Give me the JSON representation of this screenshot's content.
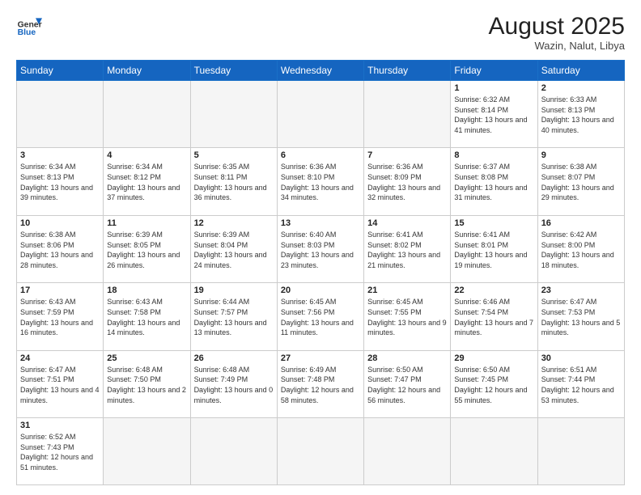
{
  "header": {
    "logo_general": "General",
    "logo_blue": "Blue",
    "month_year": "August 2025",
    "location": "Wazin, Nalut, Libya"
  },
  "weekdays": [
    "Sunday",
    "Monday",
    "Tuesday",
    "Wednesday",
    "Thursday",
    "Friday",
    "Saturday"
  ],
  "weeks": [
    [
      {
        "day": "",
        "info": ""
      },
      {
        "day": "",
        "info": ""
      },
      {
        "day": "",
        "info": ""
      },
      {
        "day": "",
        "info": ""
      },
      {
        "day": "",
        "info": ""
      },
      {
        "day": "1",
        "info": "Sunrise: 6:32 AM\nSunset: 8:14 PM\nDaylight: 13 hours and 41 minutes."
      },
      {
        "day": "2",
        "info": "Sunrise: 6:33 AM\nSunset: 8:13 PM\nDaylight: 13 hours and 40 minutes."
      }
    ],
    [
      {
        "day": "3",
        "info": "Sunrise: 6:34 AM\nSunset: 8:13 PM\nDaylight: 13 hours and 39 minutes."
      },
      {
        "day": "4",
        "info": "Sunrise: 6:34 AM\nSunset: 8:12 PM\nDaylight: 13 hours and 37 minutes."
      },
      {
        "day": "5",
        "info": "Sunrise: 6:35 AM\nSunset: 8:11 PM\nDaylight: 13 hours and 36 minutes."
      },
      {
        "day": "6",
        "info": "Sunrise: 6:36 AM\nSunset: 8:10 PM\nDaylight: 13 hours and 34 minutes."
      },
      {
        "day": "7",
        "info": "Sunrise: 6:36 AM\nSunset: 8:09 PM\nDaylight: 13 hours and 32 minutes."
      },
      {
        "day": "8",
        "info": "Sunrise: 6:37 AM\nSunset: 8:08 PM\nDaylight: 13 hours and 31 minutes."
      },
      {
        "day": "9",
        "info": "Sunrise: 6:38 AM\nSunset: 8:07 PM\nDaylight: 13 hours and 29 minutes."
      }
    ],
    [
      {
        "day": "10",
        "info": "Sunrise: 6:38 AM\nSunset: 8:06 PM\nDaylight: 13 hours and 28 minutes."
      },
      {
        "day": "11",
        "info": "Sunrise: 6:39 AM\nSunset: 8:05 PM\nDaylight: 13 hours and 26 minutes."
      },
      {
        "day": "12",
        "info": "Sunrise: 6:39 AM\nSunset: 8:04 PM\nDaylight: 13 hours and 24 minutes."
      },
      {
        "day": "13",
        "info": "Sunrise: 6:40 AM\nSunset: 8:03 PM\nDaylight: 13 hours and 23 minutes."
      },
      {
        "day": "14",
        "info": "Sunrise: 6:41 AM\nSunset: 8:02 PM\nDaylight: 13 hours and 21 minutes."
      },
      {
        "day": "15",
        "info": "Sunrise: 6:41 AM\nSunset: 8:01 PM\nDaylight: 13 hours and 19 minutes."
      },
      {
        "day": "16",
        "info": "Sunrise: 6:42 AM\nSunset: 8:00 PM\nDaylight: 13 hours and 18 minutes."
      }
    ],
    [
      {
        "day": "17",
        "info": "Sunrise: 6:43 AM\nSunset: 7:59 PM\nDaylight: 13 hours and 16 minutes."
      },
      {
        "day": "18",
        "info": "Sunrise: 6:43 AM\nSunset: 7:58 PM\nDaylight: 13 hours and 14 minutes."
      },
      {
        "day": "19",
        "info": "Sunrise: 6:44 AM\nSunset: 7:57 PM\nDaylight: 13 hours and 13 minutes."
      },
      {
        "day": "20",
        "info": "Sunrise: 6:45 AM\nSunset: 7:56 PM\nDaylight: 13 hours and 11 minutes."
      },
      {
        "day": "21",
        "info": "Sunrise: 6:45 AM\nSunset: 7:55 PM\nDaylight: 13 hours and 9 minutes."
      },
      {
        "day": "22",
        "info": "Sunrise: 6:46 AM\nSunset: 7:54 PM\nDaylight: 13 hours and 7 minutes."
      },
      {
        "day": "23",
        "info": "Sunrise: 6:47 AM\nSunset: 7:53 PM\nDaylight: 13 hours and 5 minutes."
      }
    ],
    [
      {
        "day": "24",
        "info": "Sunrise: 6:47 AM\nSunset: 7:51 PM\nDaylight: 13 hours and 4 minutes."
      },
      {
        "day": "25",
        "info": "Sunrise: 6:48 AM\nSunset: 7:50 PM\nDaylight: 13 hours and 2 minutes."
      },
      {
        "day": "26",
        "info": "Sunrise: 6:48 AM\nSunset: 7:49 PM\nDaylight: 13 hours and 0 minutes."
      },
      {
        "day": "27",
        "info": "Sunrise: 6:49 AM\nSunset: 7:48 PM\nDaylight: 12 hours and 58 minutes."
      },
      {
        "day": "28",
        "info": "Sunrise: 6:50 AM\nSunset: 7:47 PM\nDaylight: 12 hours and 56 minutes."
      },
      {
        "day": "29",
        "info": "Sunrise: 6:50 AM\nSunset: 7:45 PM\nDaylight: 12 hours and 55 minutes."
      },
      {
        "day": "30",
        "info": "Sunrise: 6:51 AM\nSunset: 7:44 PM\nDaylight: 12 hours and 53 minutes."
      }
    ],
    [
      {
        "day": "31",
        "info": "Sunrise: 6:52 AM\nSunset: 7:43 PM\nDaylight: 12 hours and 51 minutes."
      },
      {
        "day": "",
        "info": ""
      },
      {
        "day": "",
        "info": ""
      },
      {
        "day": "",
        "info": ""
      },
      {
        "day": "",
        "info": ""
      },
      {
        "day": "",
        "info": ""
      },
      {
        "day": "",
        "info": ""
      }
    ]
  ]
}
